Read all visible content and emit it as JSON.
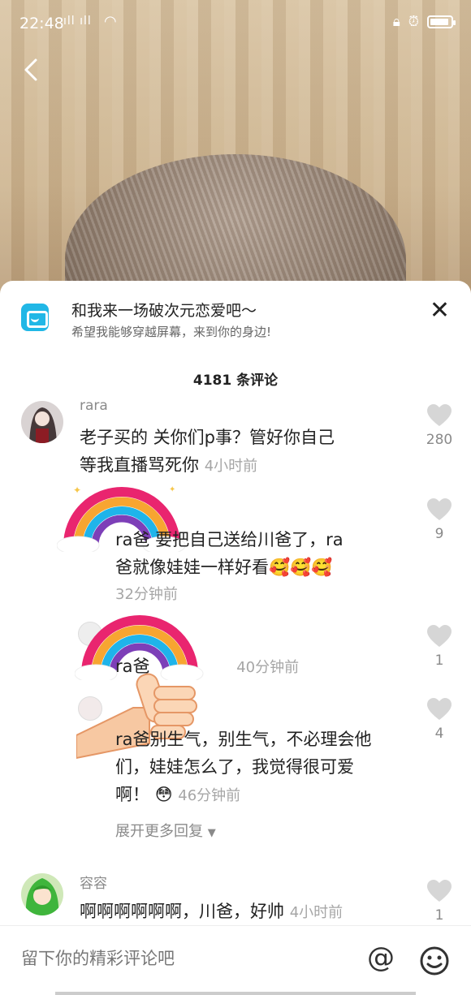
{
  "status_bar": {
    "time": "22:48",
    "signal": "⁴ᴳ",
    "right_icons": [
      "lock-icon",
      "alarm-icon"
    ]
  },
  "ad": {
    "title": "和我来一场破次元恋爱吧～",
    "subtitle": "希望我能够穿越屏幕，来到你的身边!"
  },
  "comments_header": "4181 条评论",
  "comments": [
    {
      "username": "rara",
      "line1": "老子买的 关你们p事？管好你自己",
      "line2": "等我直播骂死你",
      "time": "4小时前",
      "likes": "280"
    }
  ],
  "replies": [
    {
      "line1": "ra爸      要把自己送给川爸了，ra",
      "line2": "爸就像娃娃一样好看",
      "emojis": "🥰🥰🥰",
      "time": "32分钟前",
      "likes": "9"
    },
    {
      "line1": "ra爸",
      "time": "40分钟前",
      "likes": "1"
    },
    {
      "line1": "ra爸别生气，别生气，不必理会他",
      "line2": "们，娃娃怎么了，我觉得很可爱",
      "line3": "啊！",
      "emoji": "😳",
      "time": "46分钟前",
      "likes": "4"
    }
  ],
  "expand_more": "展开更多回复",
  "comment2": {
    "username": "容容",
    "text": "啊啊啊啊啊啊，川爸，好帅",
    "time": "4小时前",
    "likes": "1"
  },
  "input": {
    "placeholder": "留下你的精彩评论吧"
  },
  "colors": {
    "ad_icon": "#21b7e6",
    "muted_text": "#8a8a8a",
    "primary_text": "#222222"
  }
}
